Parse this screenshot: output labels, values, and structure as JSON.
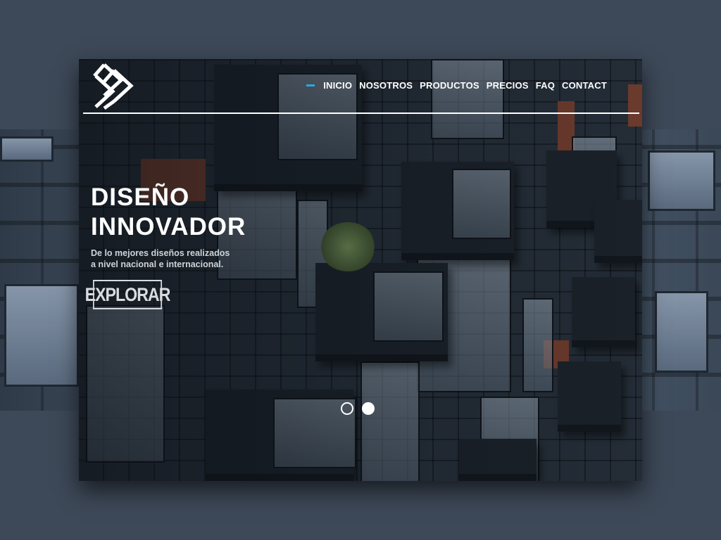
{
  "nav": {
    "active_indicator_color": "#29a8e0",
    "items": [
      {
        "label": "INICIO",
        "active": true
      },
      {
        "label": "NOSOTROS",
        "active": false
      },
      {
        "label": "PRODUCTOS",
        "active": false
      },
      {
        "label": "PRECIOS",
        "active": false
      },
      {
        "label": "FAQ",
        "active": false
      },
      {
        "label": "CONTACT",
        "active": false
      }
    ]
  },
  "logo": {
    "icon": "chevron-stack-logo-icon"
  },
  "hero": {
    "title_line1": "DISEÑO",
    "title_line2": "INNOVADOR",
    "subtitle_line1": "De lo mejores diseños realizados",
    "subtitle_line2": "a nivel nacional e internacional.",
    "button_label": "EXPLORAR"
  },
  "carousel": {
    "slides": 2,
    "active_slide": 2
  },
  "colors": {
    "page_background": "#3d4858",
    "text": "#ffffff",
    "accent": "#29a8e0"
  }
}
